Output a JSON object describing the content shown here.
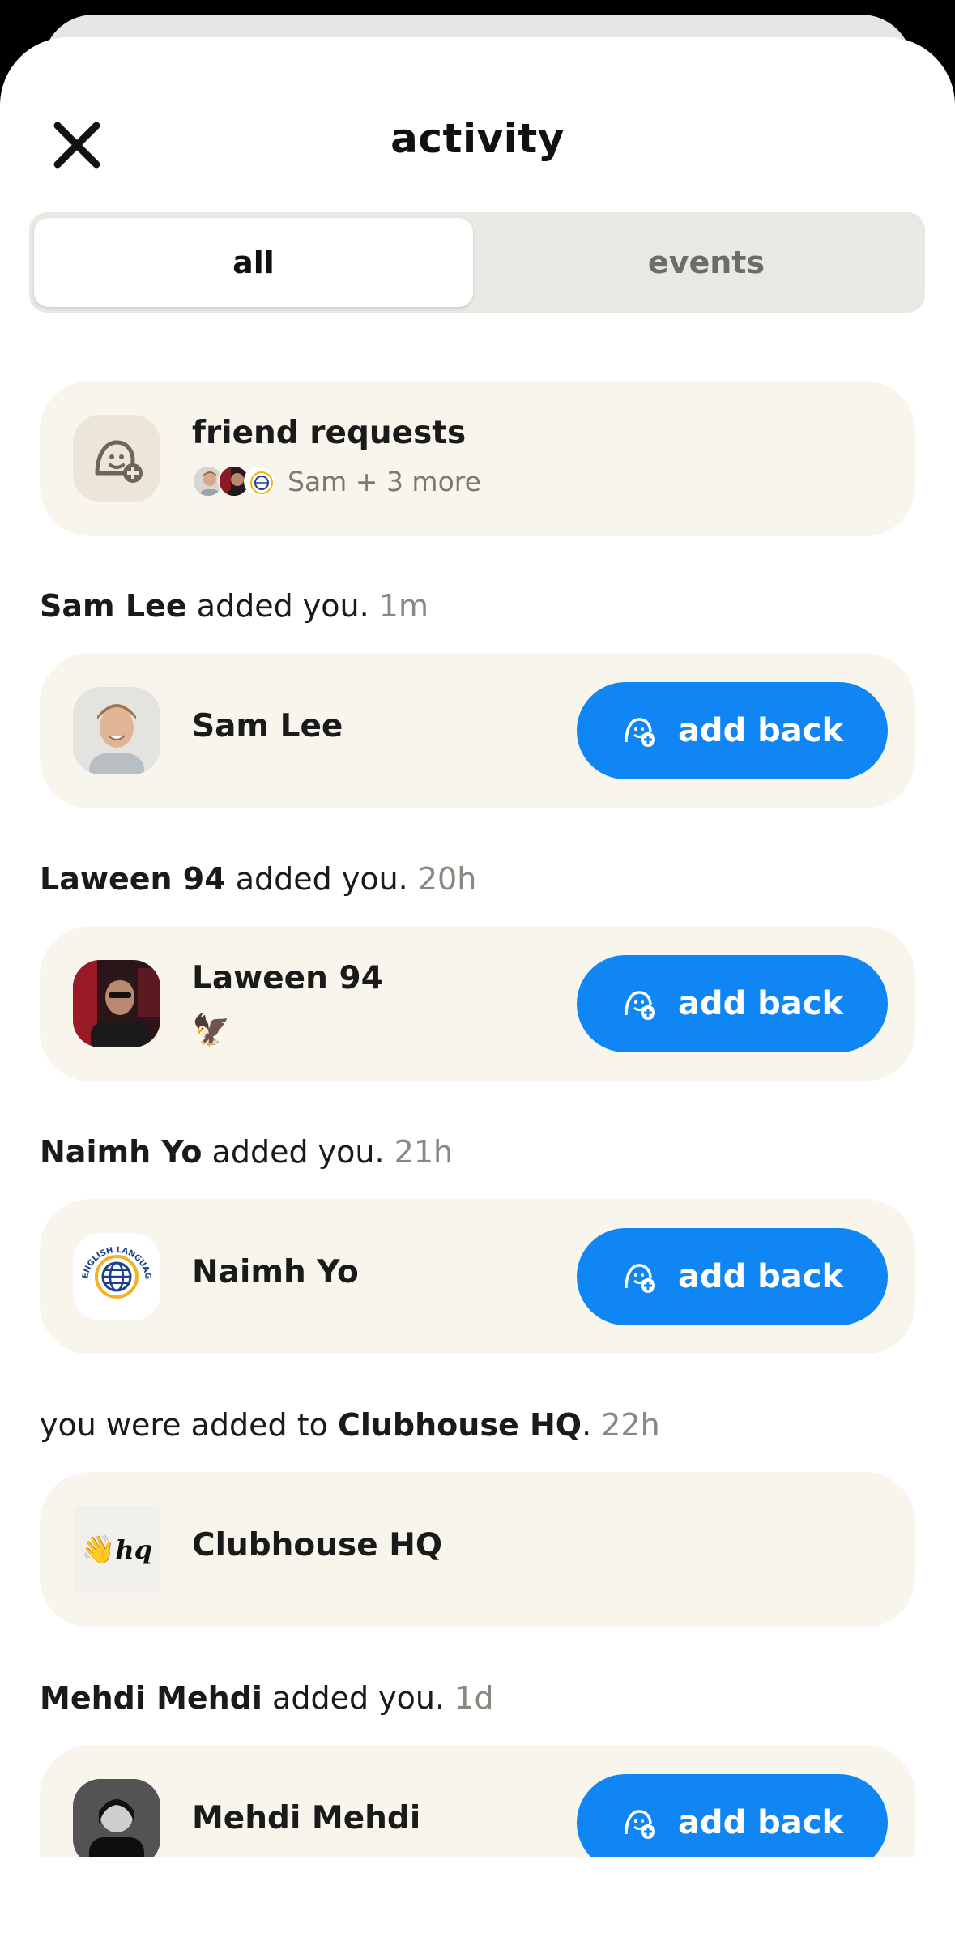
{
  "header": {
    "title": "activity",
    "close_icon": "close-icon"
  },
  "tabs": [
    {
      "label": "all",
      "active": true
    },
    {
      "label": "events",
      "active": false
    }
  ],
  "friend_requests": {
    "title": "friend requests",
    "summary": "Sam + 3 more"
  },
  "activity": [
    {
      "actor": "Sam Lee",
      "text": " added you. ",
      "time": "1m",
      "name": "Sam Lee",
      "button": "add back"
    },
    {
      "actor": "Laween 94",
      "text": " added you. ",
      "time": "20h",
      "name": "Laween 94",
      "emoji": "🦅",
      "button": "add back"
    },
    {
      "actor": "Naimh Yo",
      "text": " added you. ",
      "time": "21h",
      "name": "Naimh Yo",
      "button": "add back"
    },
    {
      "prefix": "you were added to ",
      "actor": "Clubhouse HQ",
      "text": ". ",
      "time": "22h",
      "name": "Clubhouse HQ"
    },
    {
      "actor": "Mehdi Mehdi",
      "text": " added you. ",
      "time": "1d",
      "name": "Mehdi Mehdi",
      "button": "add back"
    }
  ],
  "logos": {
    "english_club": "ENGLISH LANGUAGE CLUB",
    "hq": "hq"
  },
  "colors": {
    "accent": "#1086f5",
    "card": "#f8f6ec"
  }
}
